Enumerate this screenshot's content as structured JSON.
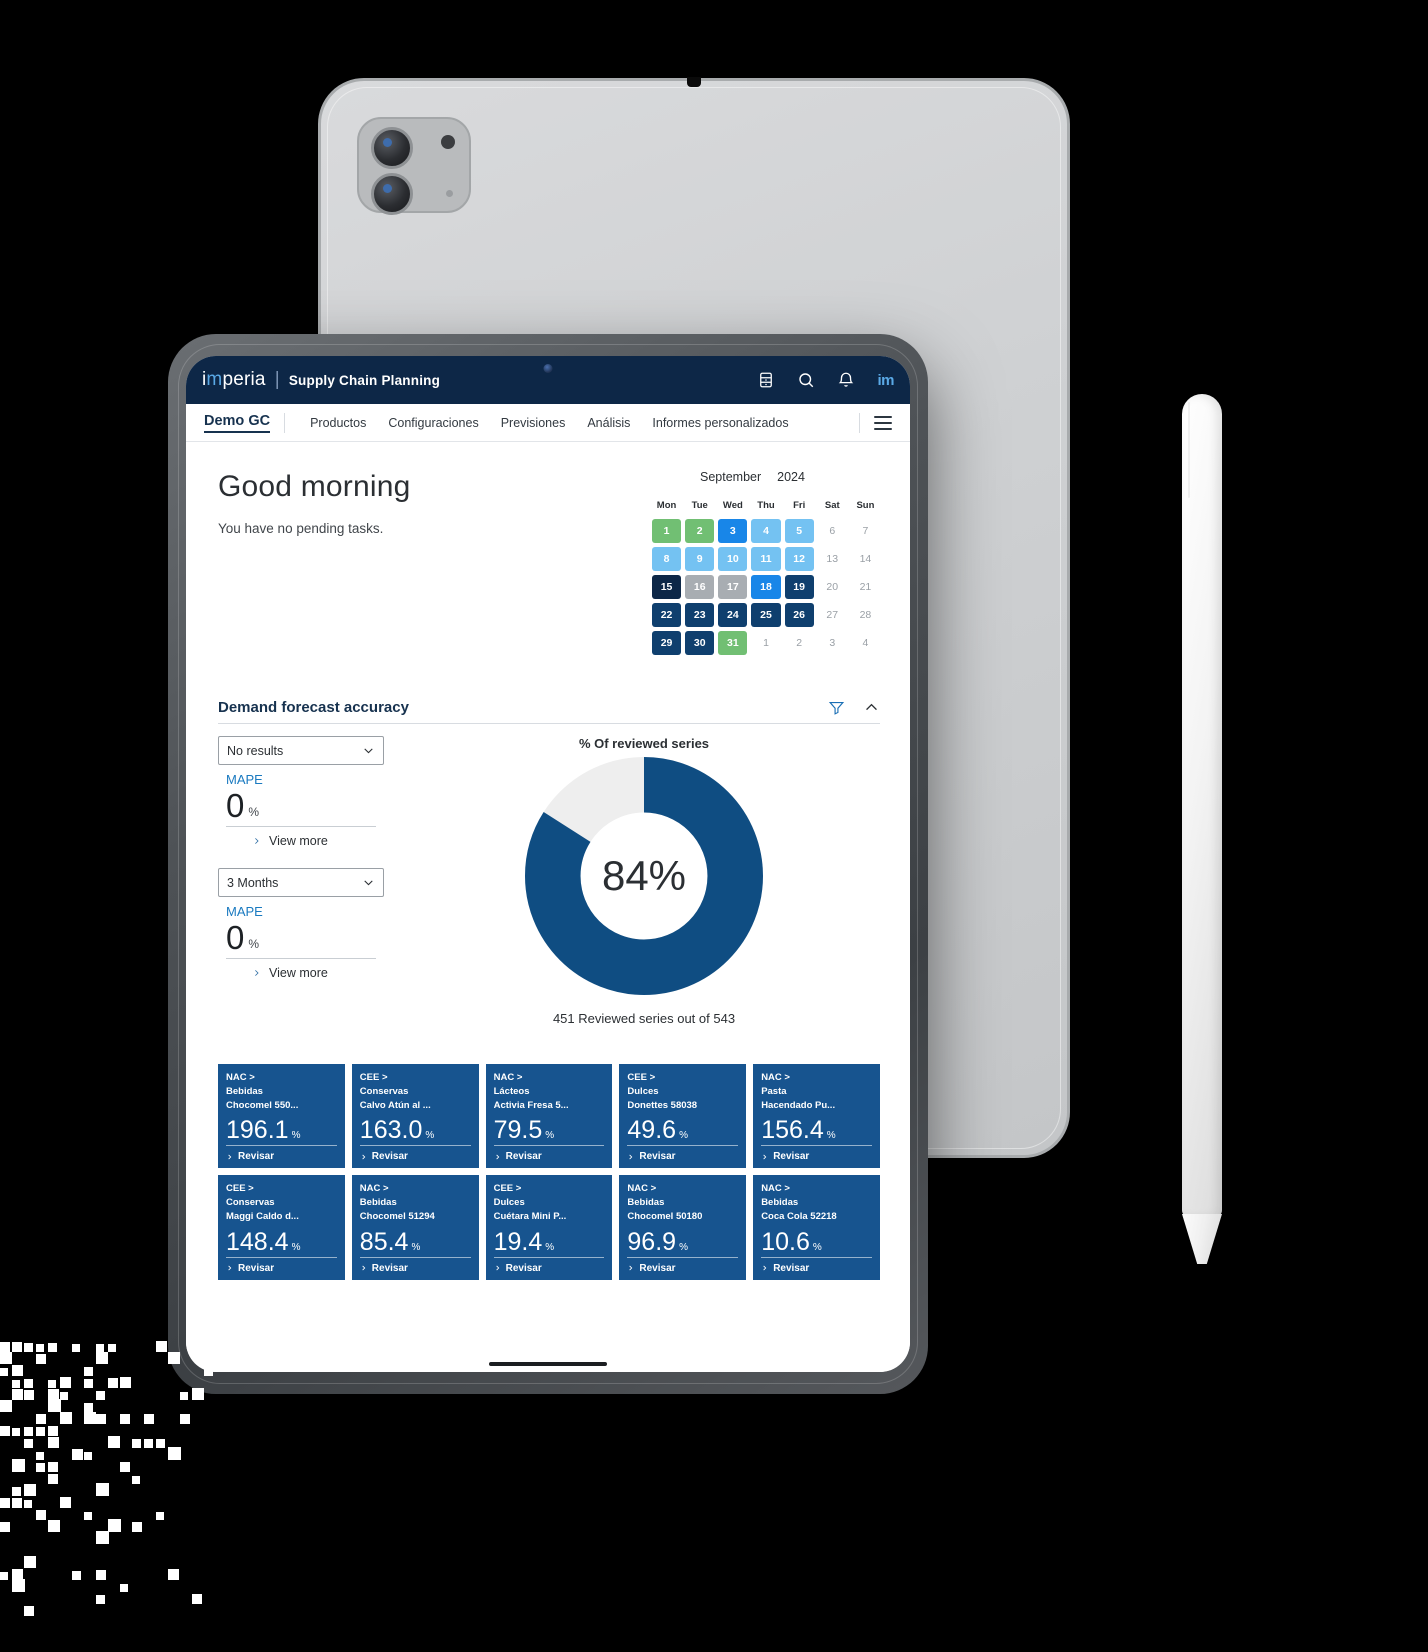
{
  "header": {
    "brand_prefix": "im",
    "brand_mm": "m",
    "brand_name": "imperia",
    "separator": "|",
    "subtitle": "Supply Chain Planning",
    "icons": [
      "calendar-icon",
      "search-icon",
      "bell-icon"
    ],
    "avatar_label": "im"
  },
  "nav": {
    "account": "Demo GC",
    "items": [
      {
        "label": "Productos"
      },
      {
        "label": "Configuraciones"
      },
      {
        "label": "Previsiones"
      },
      {
        "label": "Análisis"
      },
      {
        "label": "Informes personalizados"
      }
    ],
    "menu_icon": "hamburger-icon"
  },
  "greeting": {
    "title": "Good morning",
    "subtitle": "You have no pending tasks."
  },
  "calendar": {
    "month": "September",
    "year": "2024",
    "dow": [
      "Mon",
      "Tue",
      "Wed",
      "Thu",
      "Fri",
      "Sat",
      "Sun"
    ],
    "cells": [
      {
        "d": "1",
        "s": "green"
      },
      {
        "d": "2",
        "s": "green"
      },
      {
        "d": "3",
        "s": "bright"
      },
      {
        "d": "4",
        "s": "light"
      },
      {
        "d": "5",
        "s": "light"
      },
      {
        "d": "6",
        "s": "off"
      },
      {
        "d": "7",
        "s": "off"
      },
      {
        "d": "8",
        "s": "light"
      },
      {
        "d": "9",
        "s": "light"
      },
      {
        "d": "10",
        "s": "light"
      },
      {
        "d": "11",
        "s": "light"
      },
      {
        "d": "12",
        "s": "light"
      },
      {
        "d": "13",
        "s": "off"
      },
      {
        "d": "14",
        "s": "off"
      },
      {
        "d": "15",
        "s": "navy"
      },
      {
        "d": "16",
        "s": "gray"
      },
      {
        "d": "17",
        "s": "gray"
      },
      {
        "d": "18",
        "s": "bright"
      },
      {
        "d": "19",
        "s": "dark"
      },
      {
        "d": "20",
        "s": "off"
      },
      {
        "d": "21",
        "s": "off"
      },
      {
        "d": "22",
        "s": "dark"
      },
      {
        "d": "23",
        "s": "dark"
      },
      {
        "d": "24",
        "s": "dark"
      },
      {
        "d": "25",
        "s": "dark"
      },
      {
        "d": "26",
        "s": "dark"
      },
      {
        "d": "27",
        "s": "off"
      },
      {
        "d": "28",
        "s": "off"
      },
      {
        "d": "29",
        "s": "dark"
      },
      {
        "d": "30",
        "s": "dark"
      },
      {
        "d": "31",
        "s": "green"
      },
      {
        "d": "1",
        "s": "off"
      },
      {
        "d": "2",
        "s": "off"
      },
      {
        "d": "3",
        "s": "off"
      },
      {
        "d": "4",
        "s": "off"
      }
    ]
  },
  "widget": {
    "title": "Demand forecast accuracy",
    "filter_icon": "filter-icon",
    "collapse_icon": "chevron-up-icon",
    "metrics": [
      {
        "select_value": "No results",
        "label": "MAPE",
        "value": "0",
        "unit": "%",
        "view_more": "View more"
      },
      {
        "select_value": "3 Months",
        "label": "MAPE",
        "value": "0",
        "unit": "%",
        "view_more": "View more"
      }
    ]
  },
  "chart_data": {
    "type": "pie",
    "title": "% Of reviewed series",
    "center_label": "84%",
    "caption": "451 Reviewed series out of 543",
    "categories": [
      "Reviewed",
      "Not reviewed"
    ],
    "values": [
      84,
      16
    ],
    "colors": [
      "#0f4d82",
      "#eeeeee"
    ],
    "reviewed": 451,
    "total": 543,
    "legend": "none",
    "grid": false
  },
  "cards": [
    {
      "l1": "NAC >",
      "l2": "Bebidas",
      "l3": "Chocomel 550...",
      "value": "196.1",
      "unit": "%",
      "action": "Revisar"
    },
    {
      "l1": "CEE >",
      "l2": "Conservas",
      "l3": "Calvo Atún al ...",
      "value": "163.0",
      "unit": "%",
      "action": "Revisar"
    },
    {
      "l1": "NAC >",
      "l2": "Lácteos",
      "l3": "Activia Fresa 5...",
      "value": "79.5",
      "unit": "%",
      "action": "Revisar"
    },
    {
      "l1": "CEE >",
      "l2": "Dulces",
      "l3": "Donettes 58038",
      "value": "49.6",
      "unit": "%",
      "action": "Revisar"
    },
    {
      "l1": "NAC >",
      "l2": "Pasta",
      "l3": "Hacendado Pu...",
      "value": "156.4",
      "unit": "%",
      "action": "Revisar"
    },
    {
      "l1": "CEE >",
      "l2": "Conservas",
      "l3": "Maggi Caldo d...",
      "value": "148.4",
      "unit": "%",
      "action": "Revisar"
    },
    {
      "l1": "NAC >",
      "l2": "Bebidas",
      "l3": "Chocomel 51294",
      "value": "85.4",
      "unit": "%",
      "action": "Revisar"
    },
    {
      "l1": "CEE >",
      "l2": "Dulces",
      "l3": "Cuétara Mini P...",
      "value": "19.4",
      "unit": "%",
      "action": "Revisar"
    },
    {
      "l1": "NAC >",
      "l2": "Bebidas",
      "l3": "Chocomel 50180",
      "value": "96.9",
      "unit": "%",
      "action": "Revisar"
    },
    {
      "l1": "NAC >",
      "l2": "Bebidas",
      "l3": "Coca Cola 52218",
      "value": "10.6",
      "unit": "%",
      "action": "Revisar"
    }
  ]
}
